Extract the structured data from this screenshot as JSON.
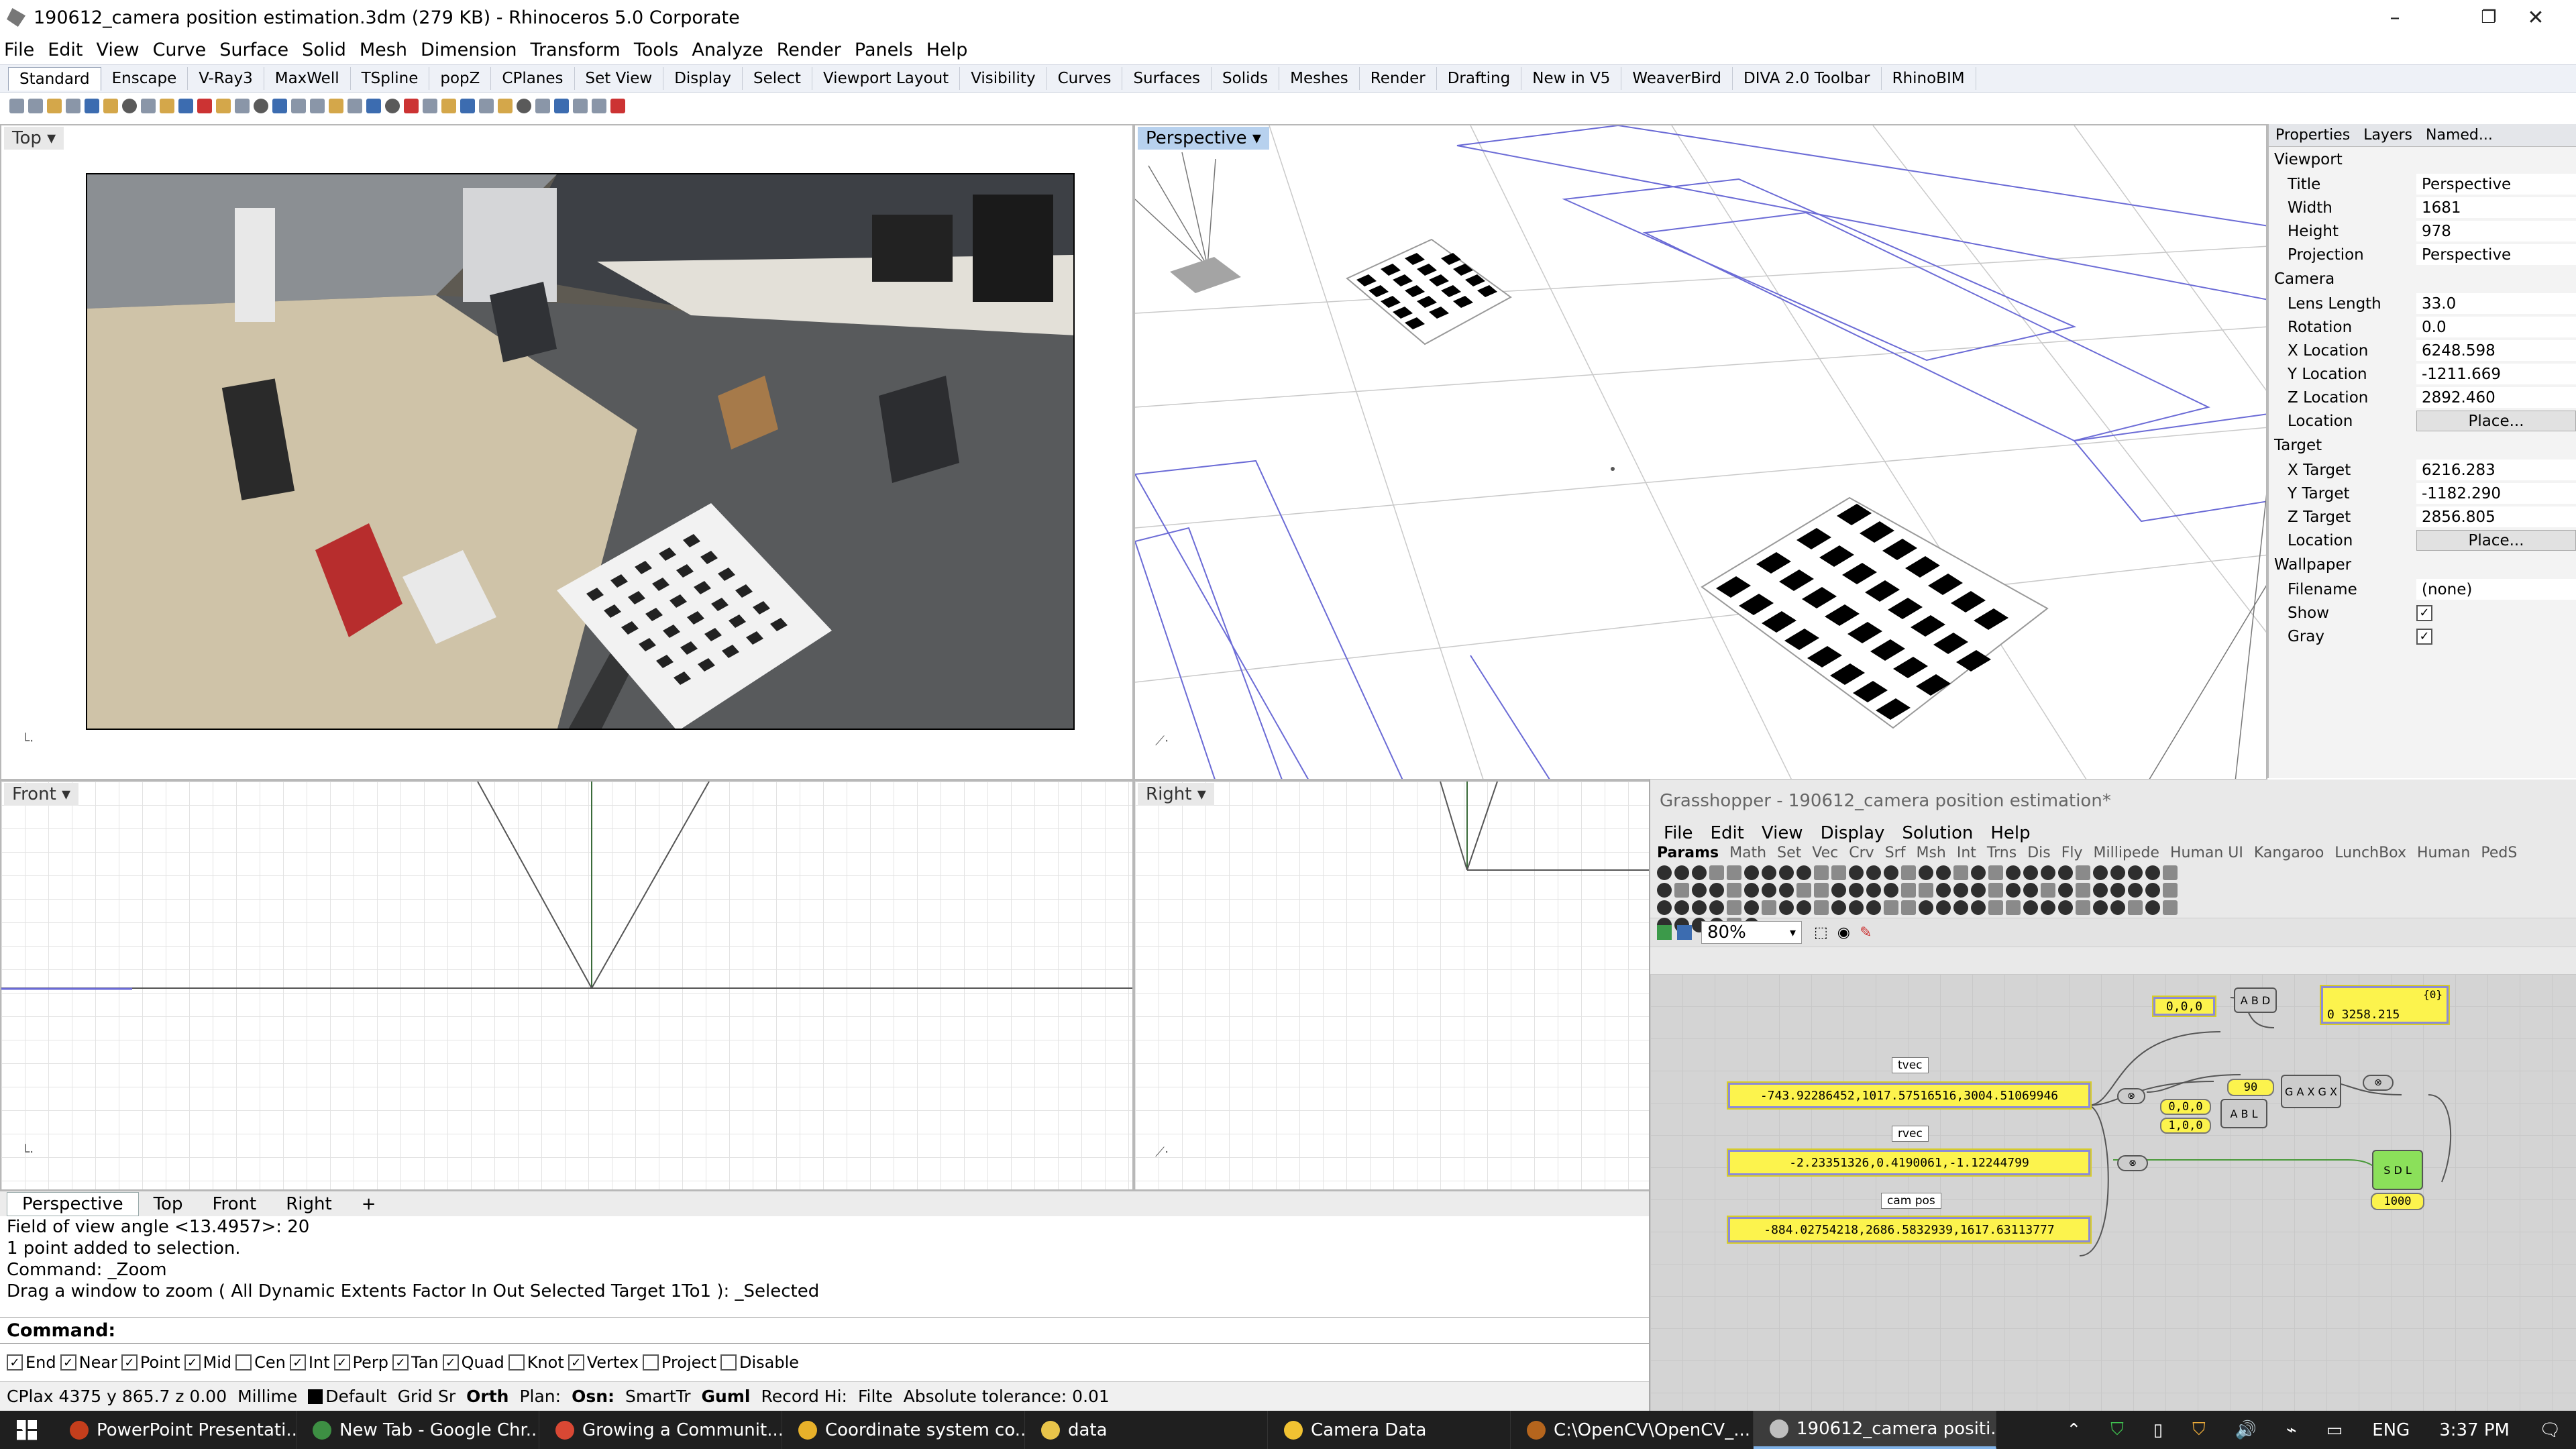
{
  "window": {
    "title": "190612_camera position estimation.3dm (279 KB) - Rhinoceros  5.0 Corporate",
    "minimize": "–",
    "maximize": "❐",
    "close": "✕"
  },
  "menu": [
    "File",
    "Edit",
    "View",
    "Curve",
    "Surface",
    "Solid",
    "Mesh",
    "Dimension",
    "Transform",
    "Tools",
    "Analyze",
    "Render",
    "Panels",
    "Help"
  ],
  "toolbar_tabs": [
    "Standard",
    "Enscape",
    "V-Ray3",
    "MaxWell",
    "TSpline",
    "popZ",
    "CPlanes",
    "Set View",
    "Display",
    "Select",
    "Viewport Layout",
    "Visibility",
    "Curves",
    "Surfaces",
    "Solids",
    "Meshes",
    "Render",
    "Drafting",
    "New in V5",
    "WeaverBird",
    "DIVA 2.0 Toolbar",
    "RhinoBIM"
  ],
  "viewports": {
    "top": "Top",
    "perspective": "Perspective",
    "front": "Front",
    "right": "Right",
    "dropdown": "▾"
  },
  "properties": {
    "tabs": [
      "Properties",
      "Layers",
      "Named..."
    ],
    "viewport_header": "Viewport",
    "title_k": "Title",
    "title_v": "Perspective",
    "width_k": "Width",
    "width_v": "1681",
    "height_k": "Height",
    "height_v": "978",
    "projection_k": "Projection",
    "projection_v": "Perspective",
    "camera_header": "Camera",
    "lens_k": "Lens Length",
    "lens_v": "33.0",
    "rotation_k": "Rotation",
    "rotation_v": "0.0",
    "xloc_k": "X Location",
    "xloc_v": "6248.598",
    "yloc_k": "Y Location",
    "yloc_v": "-1211.669",
    "zloc_k": "Z Location",
    "zloc_v": "2892.460",
    "location_k": "Location",
    "place_btn": "Place...",
    "target_header": "Target",
    "xtgt_k": "X Target",
    "xtgt_v": "6216.283",
    "ytgt_k": "Y Target",
    "ytgt_v": "-1182.290",
    "ztgt_k": "Z Target",
    "ztgt_v": "2856.805",
    "wallpaper_header": "Wallpaper",
    "filename_k": "Filename",
    "filename_v": "(none)",
    "show_k": "Show",
    "gray_k": "Gray",
    "show_checked": true,
    "gray_checked": true
  },
  "view_tabs": [
    "Perspective",
    "Top",
    "Front",
    "Right",
    "+"
  ],
  "command_history": [
    "Field of view angle <13.4957>: 20",
    "1 point added to selection.",
    "Command: _Zoom",
    "Drag a window to zoom ( All  Dynamic  Extents  Factor  In  Out  Selected  Target  1To1 ): _Selected"
  ],
  "command_prompt": "Command:",
  "osnaps": [
    {
      "label": "End",
      "on": true
    },
    {
      "label": "Near",
      "on": true
    },
    {
      "label": "Point",
      "on": true
    },
    {
      "label": "Mid",
      "on": true
    },
    {
      "label": "Cen",
      "on": false
    },
    {
      "label": "Int",
      "on": true
    },
    {
      "label": "Perp",
      "on": true
    },
    {
      "label": "Tan",
      "on": true
    },
    {
      "label": "Quad",
      "on": true
    },
    {
      "label": "Knot",
      "on": false
    },
    {
      "label": "Vertex",
      "on": true
    },
    {
      "label": "Project",
      "on": false
    },
    {
      "label": "Disable",
      "on": false
    }
  ],
  "status": {
    "cplane": "CPlax 4375 y 865.7 z 0.00",
    "units": "Millime",
    "layer": "Default",
    "grid": "Grid Sr",
    "ortho": "Orth",
    "planar": "Plan:",
    "osnap": "Osn:",
    "smarttrack": "SmartTr",
    "gumball": "Guml",
    "record": "Record Hi:",
    "filter": "Filte",
    "tolerance": "Absolute tolerance: 0.01"
  },
  "grasshopper": {
    "title": "Grasshopper - 190612_camera position estimation*",
    "menu": [
      "File",
      "Edit",
      "View",
      "Display",
      "Solution",
      "Help"
    ],
    "categories": [
      "Params",
      "Math",
      "Set",
      "Vec",
      "Crv",
      "Srf",
      "Msh",
      "Int",
      "Trns",
      "Dis",
      "Fly",
      "Millipede",
      "Human UI",
      "Kangaroo",
      "LunchBox",
      "Human",
      "PedS"
    ],
    "zoom": "80%",
    "tvec_label": "tvec",
    "tvec_value": "-743.92286452,1017.57516516,3004.51069946",
    "rvec_label": "rvec",
    "rvec_value": "-2.23351326,0.4190061,-1.12244799",
    "campos_label": "cam pos",
    "campos_value": "-884.02754218,2686.5832939,1617.63113777",
    "origin_value": "0,0,0",
    "dist_header": "{0}",
    "dist_value": "0 3258.215",
    "slider_90": "90",
    "pt_000": "0,0,0",
    "pt_100": "1,0,0",
    "slider_1000": "1000",
    "comp_d": "A  B  D",
    "comp_rot": "G  A  X  G  X",
    "comp_al": "A  B  L",
    "comp_green": "S  D  L"
  },
  "taskbar": {
    "items": [
      {
        "label": "PowerPoint Presentati...",
        "color": "#c43e1c"
      },
      {
        "label": "New Tab - Google Chr...",
        "color": "#3d8f43"
      },
      {
        "label": "Growing a Communit...",
        "color": "#d94834"
      },
      {
        "label": "Coordinate system co...",
        "color": "#e8b12a"
      },
      {
        "label": "data",
        "color": "#e8c44a"
      },
      {
        "label": "Camera Data",
        "color": "#f1c232"
      },
      {
        "label": "C:\\OpenCV\\OpenCV_...",
        "color": "#b5651d"
      },
      {
        "label": "190612_camera positi...",
        "color": "#bfbfbf"
      }
    ],
    "lang": "ENG",
    "time": "3:37 PM",
    "chevron": "⌃",
    "volume": "🔊",
    "network": "⌁",
    "battery": "▭",
    "notifications": "🗨"
  },
  "colors": {
    "accent": "#b7d1ee",
    "panel": "#fcf34d",
    "panel_border": "#8b8ad8",
    "wire": "#6b6bd6"
  }
}
